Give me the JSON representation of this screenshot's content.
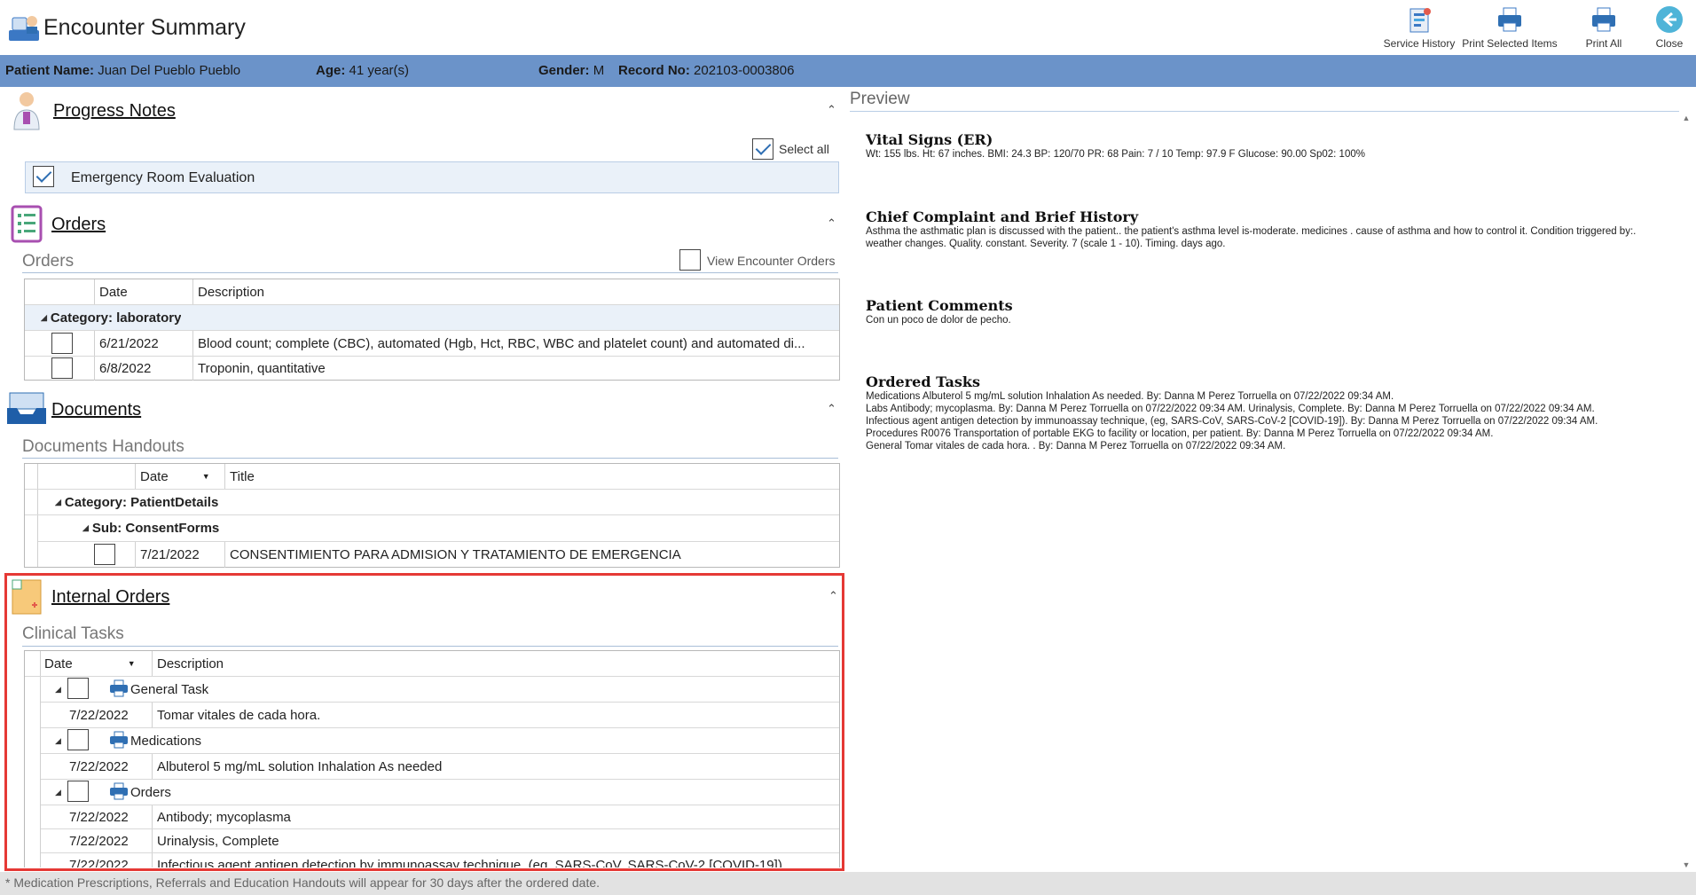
{
  "header": {
    "title": "Encounter Summary",
    "toolbar": [
      {
        "id": "service-history",
        "label": "Service History",
        "icon": "service-history-icon"
      },
      {
        "id": "print-selected",
        "label": "Print Selected Items",
        "icon": "printer-icon"
      },
      {
        "id": "print-all",
        "label": "Print All",
        "icon": "printer-icon"
      },
      {
        "id": "close",
        "label": "Close",
        "icon": "back-arrow-icon"
      }
    ]
  },
  "patient": {
    "name_label": "Patient Name:",
    "name": "Juan Del Pueblo Pueblo",
    "age_label": "Age:",
    "age": "41 year(s)",
    "gender_label": "Gender:",
    "gender": "M",
    "record_label": "Record No:",
    "record": "202103-0003806"
  },
  "progress_notes": {
    "title": "Progress Notes",
    "select_all": "Select all",
    "items": [
      "Emergency Room Evaluation"
    ]
  },
  "orders": {
    "title": "Orders",
    "subtitle": "Orders",
    "view_encounter": "View Encounter Orders",
    "columns": [
      "Date",
      "Description"
    ],
    "category": "Category: laboratory",
    "rows": [
      {
        "date": "6/21/2022",
        "desc": "Blood count; complete (CBC), automated (Hgb, Hct, RBC, WBC and platelet count) and automated di..."
      },
      {
        "date": "6/8/2022",
        "desc": "Troponin, quantitative"
      }
    ]
  },
  "documents": {
    "title": "Documents",
    "subtitle": "Documents Handouts",
    "columns": [
      "Date",
      "Title"
    ],
    "category": "Category: PatientDetails",
    "sub": "Sub: ConsentForms",
    "rows": [
      {
        "date": "7/21/2022",
        "title": "CONSENTIMIENTO PARA ADMISION Y TRATAMIENTO DE EMERGENCIA"
      }
    ]
  },
  "internal_orders": {
    "title": "Internal Orders",
    "subtitle": "Clinical Tasks",
    "columns": [
      "Date",
      "Description"
    ],
    "groups": [
      {
        "name": "General Task",
        "rows": [
          {
            "date": "7/22/2022",
            "desc": "Tomar vitales de cada hora."
          }
        ]
      },
      {
        "name": "Medications",
        "rows": [
          {
            "date": "7/22/2022",
            "desc": "Albuterol 5 mg/mL solution Inhalation  As needed"
          }
        ]
      },
      {
        "name": "Orders",
        "rows": [
          {
            "date": "7/22/2022",
            "desc": "Antibody; mycoplasma"
          },
          {
            "date": "7/22/2022",
            "desc": "Urinalysis, Complete"
          },
          {
            "date": "7/22/2022",
            "desc": "Infectious agent antigen detection by immunoassay technique, (eg, SARS-CoV, SARS-CoV-2 [COVID-19])"
          }
        ]
      }
    ]
  },
  "preview": {
    "title": "Preview",
    "sections": [
      {
        "heading": "Vital Signs (ER)",
        "lines": [
          "Wt: 155 lbs. Ht: 67 inches. BMI: 24.3 BP: 120/70 PR: 68 Pain: 7 / 10 Temp: 97.9 F Glucose: 90.00 Sp02: 100%"
        ]
      },
      {
        "heading": "Chief Complaint and Brief History",
        "lines": [
          "Asthma the asthmatic plan is discussed with the patient.. the patient's asthma level is-moderate. medicines . cause of asthma and how to control it. Condition triggered by:. weather changes. Quality. constant. Severity. 7 (scale 1 - 10). Timing. days ago."
        ]
      },
      {
        "heading": "Patient Comments",
        "lines": [
          "Con un poco de dolor de pecho."
        ]
      },
      {
        "heading": "Ordered Tasks",
        "lines": [
          "Medications Albuterol 5 mg/mL solution Inhalation As needed. By: Danna M Perez Torruella on 07/22/2022 09:34 AM.",
          "Labs Antibody; mycoplasma. By: Danna M Perez Torruella on 07/22/2022 09:34 AM. Urinalysis, Complete. By: Danna M Perez Torruella on 07/22/2022 09:34 AM.",
          "Infectious agent antigen detection by immunoassay technique, (eg, SARS-CoV, SARS-CoV-2 [COVID-19]). By: Danna M Perez Torruella on 07/22/2022 09:34 AM.",
          "Procedures R0076 Transportation of portable EKG to facility or location, per patient. By: Danna M Perez Torruella on 07/22/2022 09:34 AM.",
          "General Tomar vitales de cada hora. . By: Danna M Perez Torruella on 07/22/2022 09:34 AM."
        ]
      }
    ]
  },
  "footer": "* Medication Prescriptions, Referrals and Education Handouts will appear for 30 days after the ordered date.",
  "colors": {
    "accent": "#6b93c9",
    "highlight": "#e53935",
    "group_bg": "#eaf1f9"
  }
}
